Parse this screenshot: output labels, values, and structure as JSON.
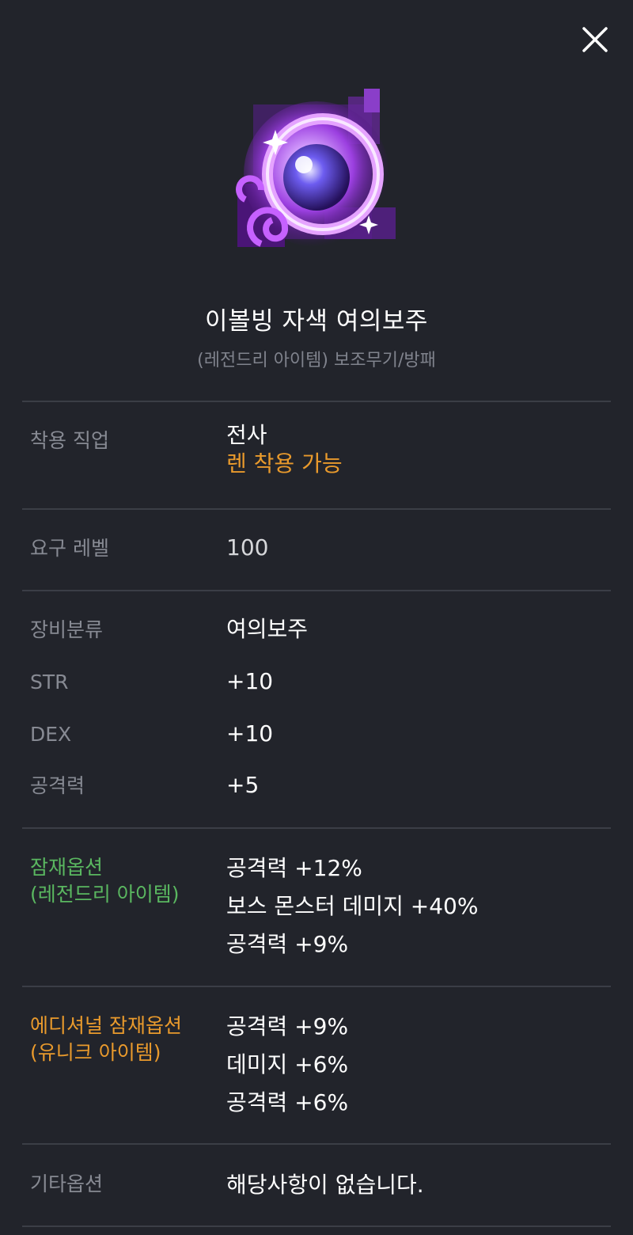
{
  "header": {
    "close_icon": "close-icon"
  },
  "item": {
    "icon": "purple-orb-icon",
    "name": "이볼빙 자색 여의보주",
    "subtitle": "(레전드리 아이템) 보조무기/방패"
  },
  "sections": {
    "job": {
      "label": "착용 직업",
      "value": "전사",
      "note": "렌 착용 가능"
    },
    "level": {
      "label": "요구 레벨",
      "value": "100"
    },
    "stats": [
      {
        "label": "장비분류",
        "value": "여의보주"
      },
      {
        "label": "STR",
        "value": "+10"
      },
      {
        "label": "DEX",
        "value": "+10"
      },
      {
        "label": "공격력",
        "value": "+5"
      }
    ],
    "potential": {
      "label": "잠재옵션\n(레전드리 아이템)",
      "lines": [
        "공격력 +12%",
        "보스 몬스터 데미지 +40%",
        "공격력 +9%"
      ]
    },
    "additional_potential": {
      "label": "에디셔널 잠재옵션\n(유니크 아이템)",
      "lines": [
        "공격력 +9%",
        "데미지 +6%",
        "공격력 +6%"
      ]
    },
    "other": {
      "label": "기타옵션",
      "value": "해당사항이 없습니다."
    }
  },
  "colors": {
    "background": "#22242b",
    "divider": "#3b3e46",
    "label": "#878a93",
    "legendary_green": "#5ab760",
    "unique_orange": "#e99a2c"
  }
}
